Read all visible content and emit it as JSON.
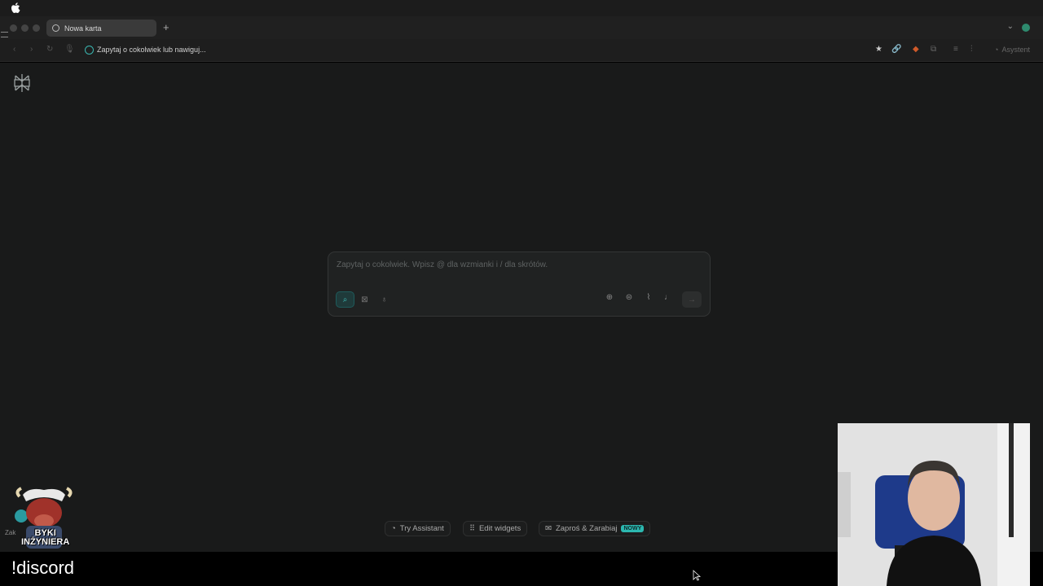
{
  "browser": {
    "tab_title": "Nowa karta",
    "new_tab_glyph": "+",
    "address_text": "Zapytaj o cokolwiek lub nawiguj...",
    "assistant_label": "Asystent"
  },
  "search": {
    "placeholder": "Zapytaj o cokolwiek. Wpisz @ dla wzmianki i / dla skrótów.",
    "modes": [
      "search-icon",
      "research-icon",
      "lightbulb-icon"
    ],
    "tools": [
      "globe-icon",
      "chip-icon",
      "paperclip-icon",
      "microphone-icon"
    ],
    "send_glyph": "→"
  },
  "footer": {
    "try_assistant": "Try Assistant",
    "edit_widgets": "Edit widgets",
    "invite": "Zaproś & Zarabiaj",
    "invite_badge": "NOWY"
  },
  "overlay": {
    "mascot_line1": "BYKI",
    "mascot_line2": "INŻYNIERA",
    "mascot_side": "Zak",
    "caption": "!discord"
  },
  "colors": {
    "accent": "#3ec0bb",
    "page_bg": "#191a1a",
    "badge_bg": "#2cb8b0"
  }
}
